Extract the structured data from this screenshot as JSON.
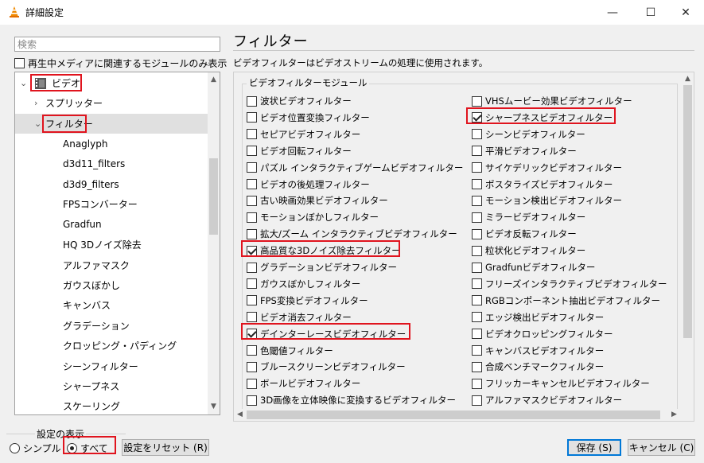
{
  "window": {
    "title": "詳細設定",
    "minimize": "—",
    "maximize": "☐",
    "close": "✕"
  },
  "search": {
    "placeholder": "検索",
    "value": ""
  },
  "only_current_media": {
    "label": "再生中メディアに関連するモジュールのみ表示",
    "checked": false
  },
  "tree": {
    "items": [
      {
        "label": "ビデオ",
        "level": 0,
        "expanded": true,
        "icon": "video-icon"
      },
      {
        "label": "スプリッター",
        "level": 1,
        "expanded": false
      },
      {
        "label": "フィルター",
        "level": 1,
        "expanded": true,
        "selected": true
      },
      {
        "label": "Anaglyph",
        "level": 2
      },
      {
        "label": "d3d11_filters",
        "level": 2
      },
      {
        "label": "d3d9_filters",
        "level": 2
      },
      {
        "label": "FPSコンバーター",
        "level": 2
      },
      {
        "label": "Gradfun",
        "level": 2
      },
      {
        "label": "HQ 3Dノイズ除去",
        "level": 2
      },
      {
        "label": "アルファマスク",
        "level": 2
      },
      {
        "label": "ガウスぼかし",
        "level": 2
      },
      {
        "label": "キャンバス",
        "level": 2
      },
      {
        "label": "グラデーション",
        "level": 2
      },
      {
        "label": "クロッピング・パディング",
        "level": 2
      },
      {
        "label": "シーンフィルター",
        "level": 2
      },
      {
        "label": "シャープネス",
        "level": 2
      },
      {
        "label": "スケーリング",
        "level": 2
      }
    ]
  },
  "panel": {
    "title": "フィルター",
    "description": "ビデオフィルターはビデオストリームの処理に使用されます。",
    "group_label": "ビデオフィルターモジュール"
  },
  "filters_left": [
    {
      "label": "波状ビデオフィルター",
      "checked": false
    },
    {
      "label": "ビデオ位置変換フィルター",
      "checked": false
    },
    {
      "label": "セピアビデオフィルター",
      "checked": false
    },
    {
      "label": "ビデオ回転フィルター",
      "checked": false
    },
    {
      "label": "パズル インタラクティブゲームビデオフィルター",
      "checked": false
    },
    {
      "label": "ビデオの後処理フィルター",
      "checked": false
    },
    {
      "label": "古い映画効果ビデオフィルター",
      "checked": false
    },
    {
      "label": "モーションぼかしフィルター",
      "checked": false
    },
    {
      "label": "拡大/ズーム インタラクティブビデオフィルター",
      "checked": false
    },
    {
      "label": "高品質な3Dノイズ除去フィルター",
      "checked": true
    },
    {
      "label": "グラデーションビデオフィルター",
      "checked": false
    },
    {
      "label": "ガウスぼかしフィルター",
      "checked": false
    },
    {
      "label": "FPS変換ビデオフィルター",
      "checked": false
    },
    {
      "label": "ビデオ消去フィルター",
      "checked": false
    },
    {
      "label": "デインターレースビデオフィルター",
      "checked": true
    },
    {
      "label": "色閾値フィルター",
      "checked": false
    },
    {
      "label": "ブルースクリーンビデオフィルター",
      "checked": false
    },
    {
      "label": "ボールビデオフィルター",
      "checked": false
    },
    {
      "label": "3D画像を立体映像に変換するビデオフィルター",
      "checked": false
    }
  ],
  "filters_right": [
    {
      "label": "VHSムービー効果ビデオフィルター",
      "checked": false
    },
    {
      "label": "シャープネスビデオフィルター",
      "checked": true
    },
    {
      "label": "シーンビデオフィルター",
      "checked": false
    },
    {
      "label": "平滑ビデオフィルター",
      "checked": false
    },
    {
      "label": "サイケデリックビデオフィルター",
      "checked": false
    },
    {
      "label": "ポスタライズビデオフィルター",
      "checked": false
    },
    {
      "label": "モーション検出ビデオフィルター",
      "checked": false
    },
    {
      "label": "ミラービデオフィルター",
      "checked": false
    },
    {
      "label": "ビデオ反転フィルター",
      "checked": false
    },
    {
      "label": "粒状化ビデオフィルター",
      "checked": false
    },
    {
      "label": "Gradfunビデオフィルター",
      "checked": false
    },
    {
      "label": "フリーズインタラクティブビデオフィルター",
      "checked": false
    },
    {
      "label": "RGBコンポーネント抽出ビデオフィルター",
      "checked": false
    },
    {
      "label": "エッジ検出ビデオフィルター",
      "checked": false
    },
    {
      "label": "ビデオクロッピングフィルター",
      "checked": false
    },
    {
      "label": "キャンバスビデオフィルター",
      "checked": false
    },
    {
      "label": "合成ベンチマークフィルター",
      "checked": false
    },
    {
      "label": "フリッカーキャンセルビデオフィルター",
      "checked": false
    },
    {
      "label": "アルファマスクビデオフィルター",
      "checked": false
    }
  ],
  "bottom": {
    "display_group_label": "設定の表示",
    "simple_label": "シンプル",
    "all_label": "すべて",
    "reset_label": "設定をリセット (R)",
    "save_label": "保存 (S)",
    "cancel_label": "キャンセル (C)"
  },
  "colors": {
    "annotation": "#e0141e",
    "accent": "#0078d7"
  }
}
